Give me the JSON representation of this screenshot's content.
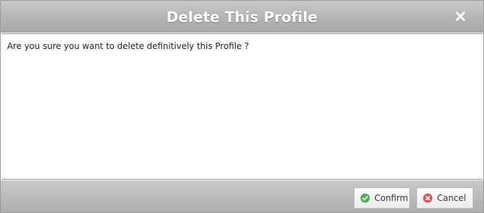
{
  "dialog": {
    "title": "Delete This Profile",
    "close_icon": "close-icon",
    "message": "Are you sure you want to delete definitively this Profile ?"
  },
  "buttons": {
    "confirm": {
      "label": "Confirm",
      "icon": "check-circle-icon",
      "icon_color": "#4caf50"
    },
    "cancel": {
      "label": "Cancel",
      "icon": "cancel-circle-icon",
      "icon_color": "#d9534f"
    }
  },
  "colors": {
    "titlebar": "#b3b3b3",
    "title_text": "#ffffff",
    "footer": "#b8b8b8"
  }
}
